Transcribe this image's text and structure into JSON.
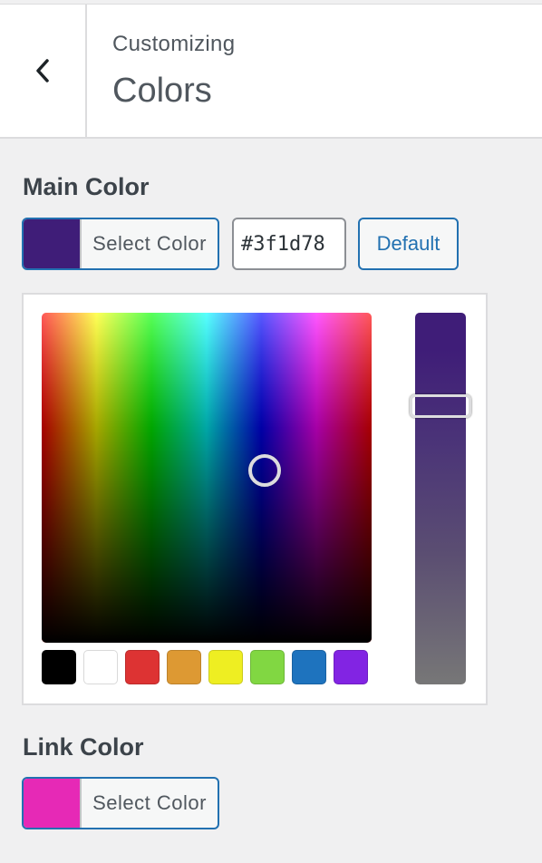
{
  "header": {
    "subtitle": "Customizing",
    "title": "Colors",
    "back_icon": "chevron-left-icon"
  },
  "main_color": {
    "label": "Main Color",
    "swatch_color": "#3f1d78",
    "select_label": "Select Color",
    "hex_value": "#3f1d78",
    "default_label": "Default"
  },
  "picker": {
    "palette": [
      "#000000",
      "#ffffff",
      "#dd3333",
      "#dd9933",
      "#eeee22",
      "#81d742",
      "#1e73be",
      "#8224e3"
    ]
  },
  "link_color": {
    "label": "Link Color",
    "swatch_color": "#e629b6",
    "select_label": "Select Color"
  }
}
